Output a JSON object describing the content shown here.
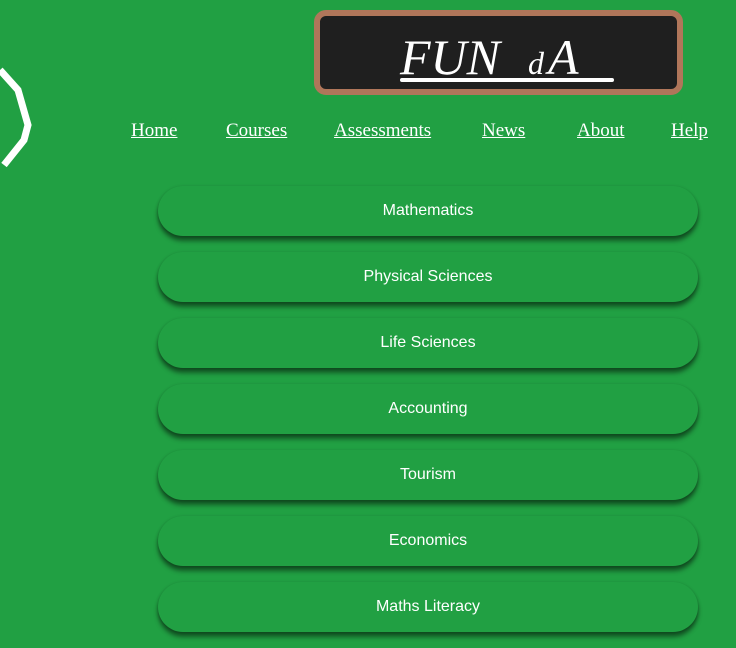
{
  "logo": {
    "text_main": "FUN",
    "text_small": "d",
    "text_end": "A"
  },
  "nav": {
    "items": [
      {
        "label": "Home"
      },
      {
        "label": "Courses"
      },
      {
        "label": "Assessments"
      },
      {
        "label": "News"
      },
      {
        "label": "About"
      },
      {
        "label": "Help"
      }
    ]
  },
  "courses": [
    {
      "label": "Mathematics"
    },
    {
      "label": "Physical Sciences"
    },
    {
      "label": "Life Sciences"
    },
    {
      "label": "Accounting"
    },
    {
      "label": "Tourism"
    },
    {
      "label": "Economics"
    },
    {
      "label": "Maths Literacy"
    }
  ],
  "colors": {
    "background": "#21a043",
    "board": "#1f1f1f",
    "board_frame": "#b0765a",
    "text": "#ffffff"
  }
}
